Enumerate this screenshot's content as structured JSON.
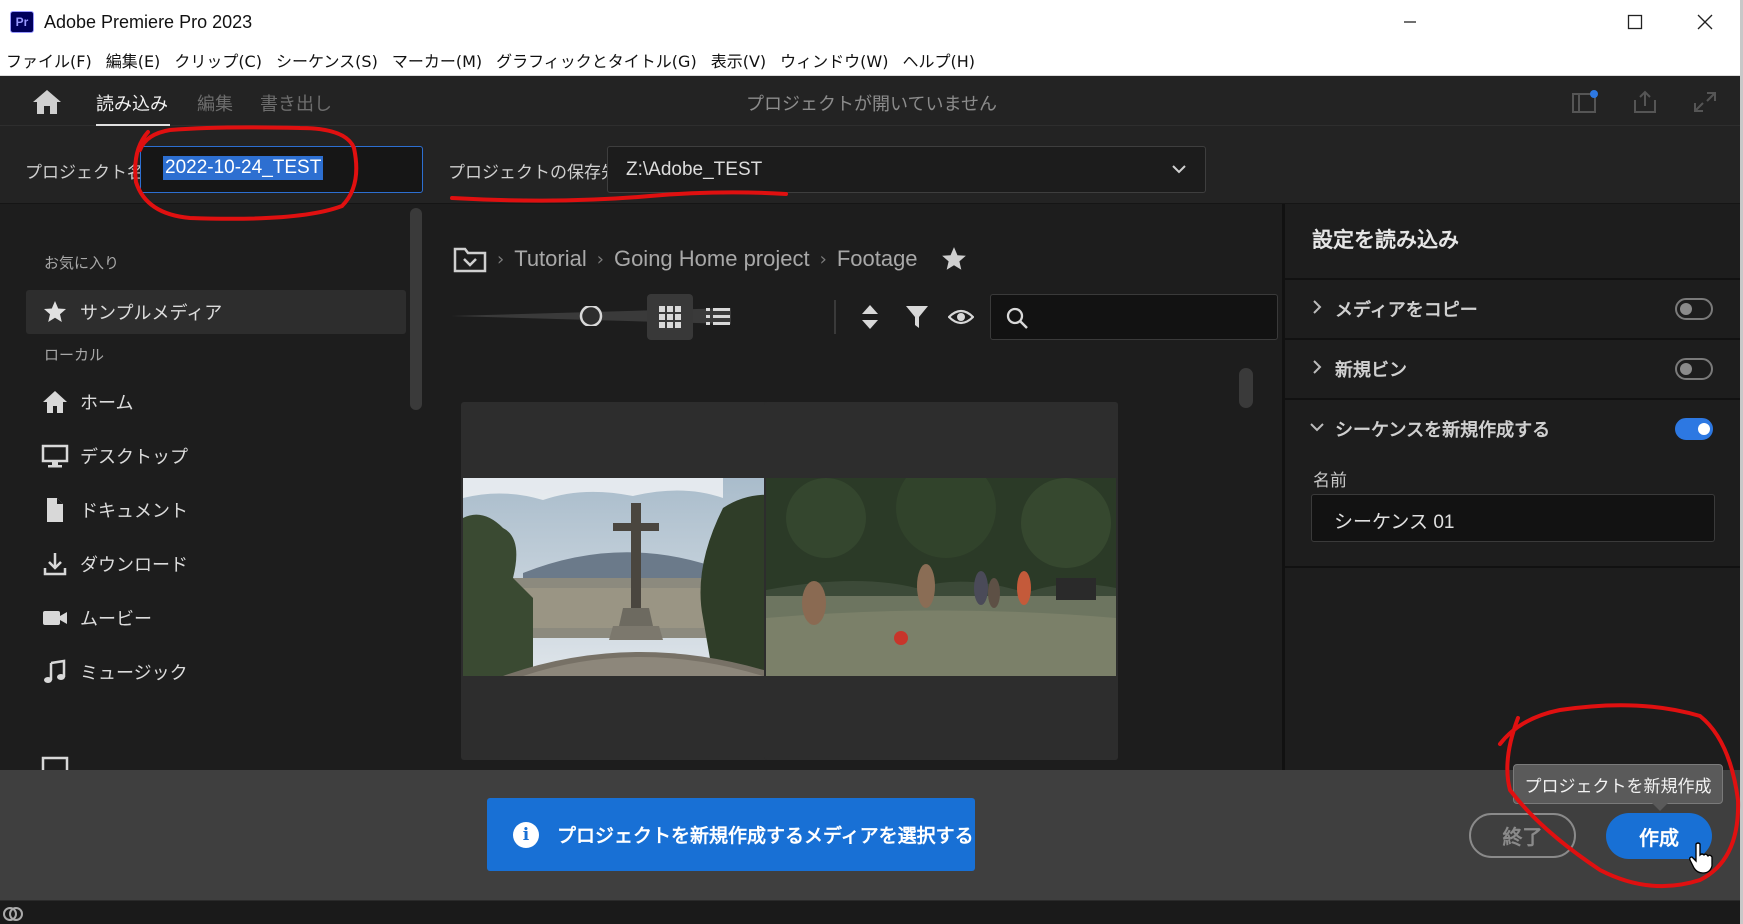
{
  "window": {
    "app_icon_text": "Pr",
    "title": "Adobe Premiere Pro 2023"
  },
  "menu": [
    "ファイル(F)",
    "編集(E)",
    "クリップ(C)",
    "シーケンス(S)",
    "マーカー(M)",
    "グラフィックとタイトル(G)",
    "表示(V)",
    "ウィンドウ(W)",
    "ヘルプ(H)"
  ],
  "header": {
    "tabs": {
      "import": "読み込み",
      "edit": "編集",
      "export": "書き出し"
    },
    "status": "プロジェクトが開いていません"
  },
  "project": {
    "name_label": "プロジェクト名",
    "name_value": "2022-10-24_TEST",
    "location_label": "プロジェクトの保存先",
    "location_value": "Z:\\Adobe_TEST"
  },
  "sidebar": {
    "favorites_heading": "お気に入り",
    "favorites": [
      {
        "label": "サンプルメディア",
        "icon": "star-icon"
      }
    ],
    "local_heading": "ローカル",
    "local": [
      {
        "label": "ホーム",
        "icon": "home-icon"
      },
      {
        "label": "デスクトップ",
        "icon": "desktop-icon"
      },
      {
        "label": "ドキュメント",
        "icon": "document-icon"
      },
      {
        "label": "ダウンロード",
        "icon": "download-icon"
      },
      {
        "label": "ムービー",
        "icon": "movie-icon"
      },
      {
        "label": "ミュージック",
        "icon": "music-icon"
      }
    ]
  },
  "browser": {
    "breadcrumb": [
      "Tutorial",
      "Going Home project",
      "Footage"
    ],
    "search_placeholder": "",
    "zoom_level": 0.5,
    "view_mode": "grid"
  },
  "settings": {
    "title": "設定を読み込み",
    "copy_media": {
      "label": "メディアをコピー",
      "enabled": false
    },
    "new_bin": {
      "label": "新規ビン",
      "enabled": false
    },
    "new_sequence": {
      "label": "シーケンスを新規作成する",
      "enabled": true
    },
    "name_label": "名前",
    "sequence_name": "シーケンス 01"
  },
  "footer": {
    "info_message": "プロジェクトを新規作成するメディアを選択する",
    "exit_label": "終了",
    "create_label": "作成",
    "tooltip": "プロジェクトを新規作成"
  },
  "colors": {
    "accent": "#1870d5",
    "annotation": "#e01010"
  }
}
